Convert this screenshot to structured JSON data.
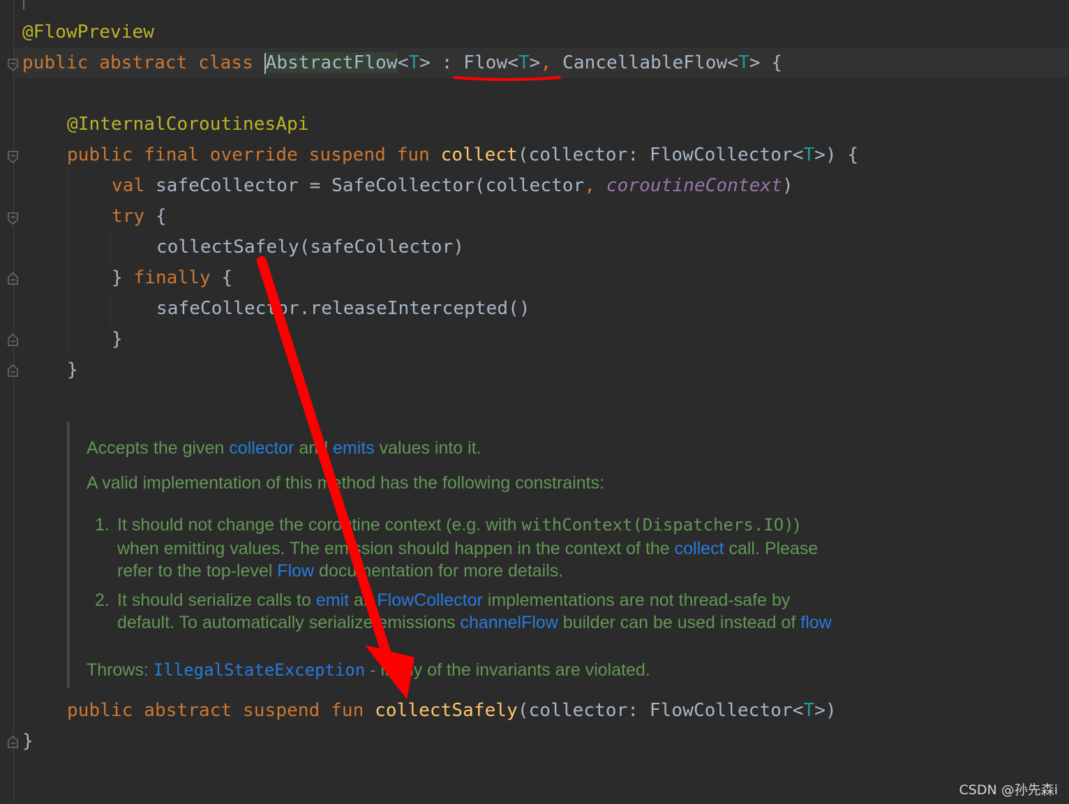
{
  "code": {
    "annotation1": "@FlowPreview",
    "class_decl": {
      "kw_public": "public",
      "kw_abstract": "abstract",
      "kw_class": "class",
      "class_name": "AbstractFlow",
      "lt1": "<",
      "T1": "T",
      "gt1": ">",
      "colon": " : ",
      "flow": "Flow",
      "lt2": "<",
      "T2": "T",
      "gt2": ">",
      "comma": ",",
      "cancellable": " CancellableFlow",
      "lt3": "<",
      "T3": "T",
      "gt3": ">",
      "brace": " {"
    },
    "annotation2": "@InternalCoroutinesApi",
    "collect_decl": {
      "mods": "public final override suspend fun ",
      "name": "collect",
      "params": "(collector: FlowCollector<",
      "T": "T",
      "end": ">) {"
    },
    "val_line": {
      "kw": "val",
      "rest": " safeCollector = SafeCollector(collector",
      "comma": ", ",
      "ctx": "coroutineContext",
      "close": ")"
    },
    "try_line": {
      "kw": "try",
      "rest": " {"
    },
    "collect_safely_call": "collectSafely(safeCollector)",
    "finally_line": {
      "brace": "} ",
      "kw": "finally",
      "rest": " {"
    },
    "release_call": "safeCollector.releaseIntercepted()",
    "close_inner": "}",
    "close_fun": "}",
    "abstract_decl": {
      "mods": "public abstract suspend fun ",
      "name": "collectSafely",
      "params": "(collector: FlowCollector<",
      "T": "T",
      "end": ">)"
    },
    "close_class": "}"
  },
  "doc": {
    "p1_a": "Accepts the given ",
    "p1_link1": "collector",
    "p1_b": " and ",
    "p1_link2": "emits",
    "p1_c": " values into it.",
    "p2": "A valid implementation of this method has the following constraints:",
    "li1_num": "1.",
    "li1_l1_a": "It should not change the coroutine context (e.g. with ",
    "li1_l1_code": "withContext(Dispatchers.IO)",
    "li1_l1_b": ")",
    "li1_l2_a": "when emitting values. The emission should happen in the context of the ",
    "li1_l2_link": "collect",
    "li1_l2_b": " call. Please",
    "li1_l3_a": "refer to the top-level ",
    "li1_l3_link": "Flow",
    "li1_l3_b": " documentation for more details.",
    "li2_num": "2.",
    "li2_l1_a": "It should serialize calls to ",
    "li2_l1_link1": "emit",
    "li2_l1_b": " as ",
    "li2_l1_link2": "FlowCollector",
    "li2_l1_c": " implementations are not thread-safe by",
    "li2_l2_a": "default. To automatically serialize emissions ",
    "li2_l2_link1": "channelFlow",
    "li2_l2_b": " builder can be used instead of ",
    "li2_l2_link2": "flow",
    "throws_label": "Throws: ",
    "throws_link": "IllegalStateException",
    "throws_rest": " - if any of the invariants are violated."
  },
  "watermark": "CSDN @孙先森i",
  "colors": {
    "background": "#2b2b2b",
    "keyword": "#cc7832",
    "annotation": "#bbb529",
    "function": "#ffc66d",
    "type_param": "#20999d",
    "doc_text": "#629755",
    "doc_link": "#287bde",
    "arrow": "#ff0000"
  }
}
